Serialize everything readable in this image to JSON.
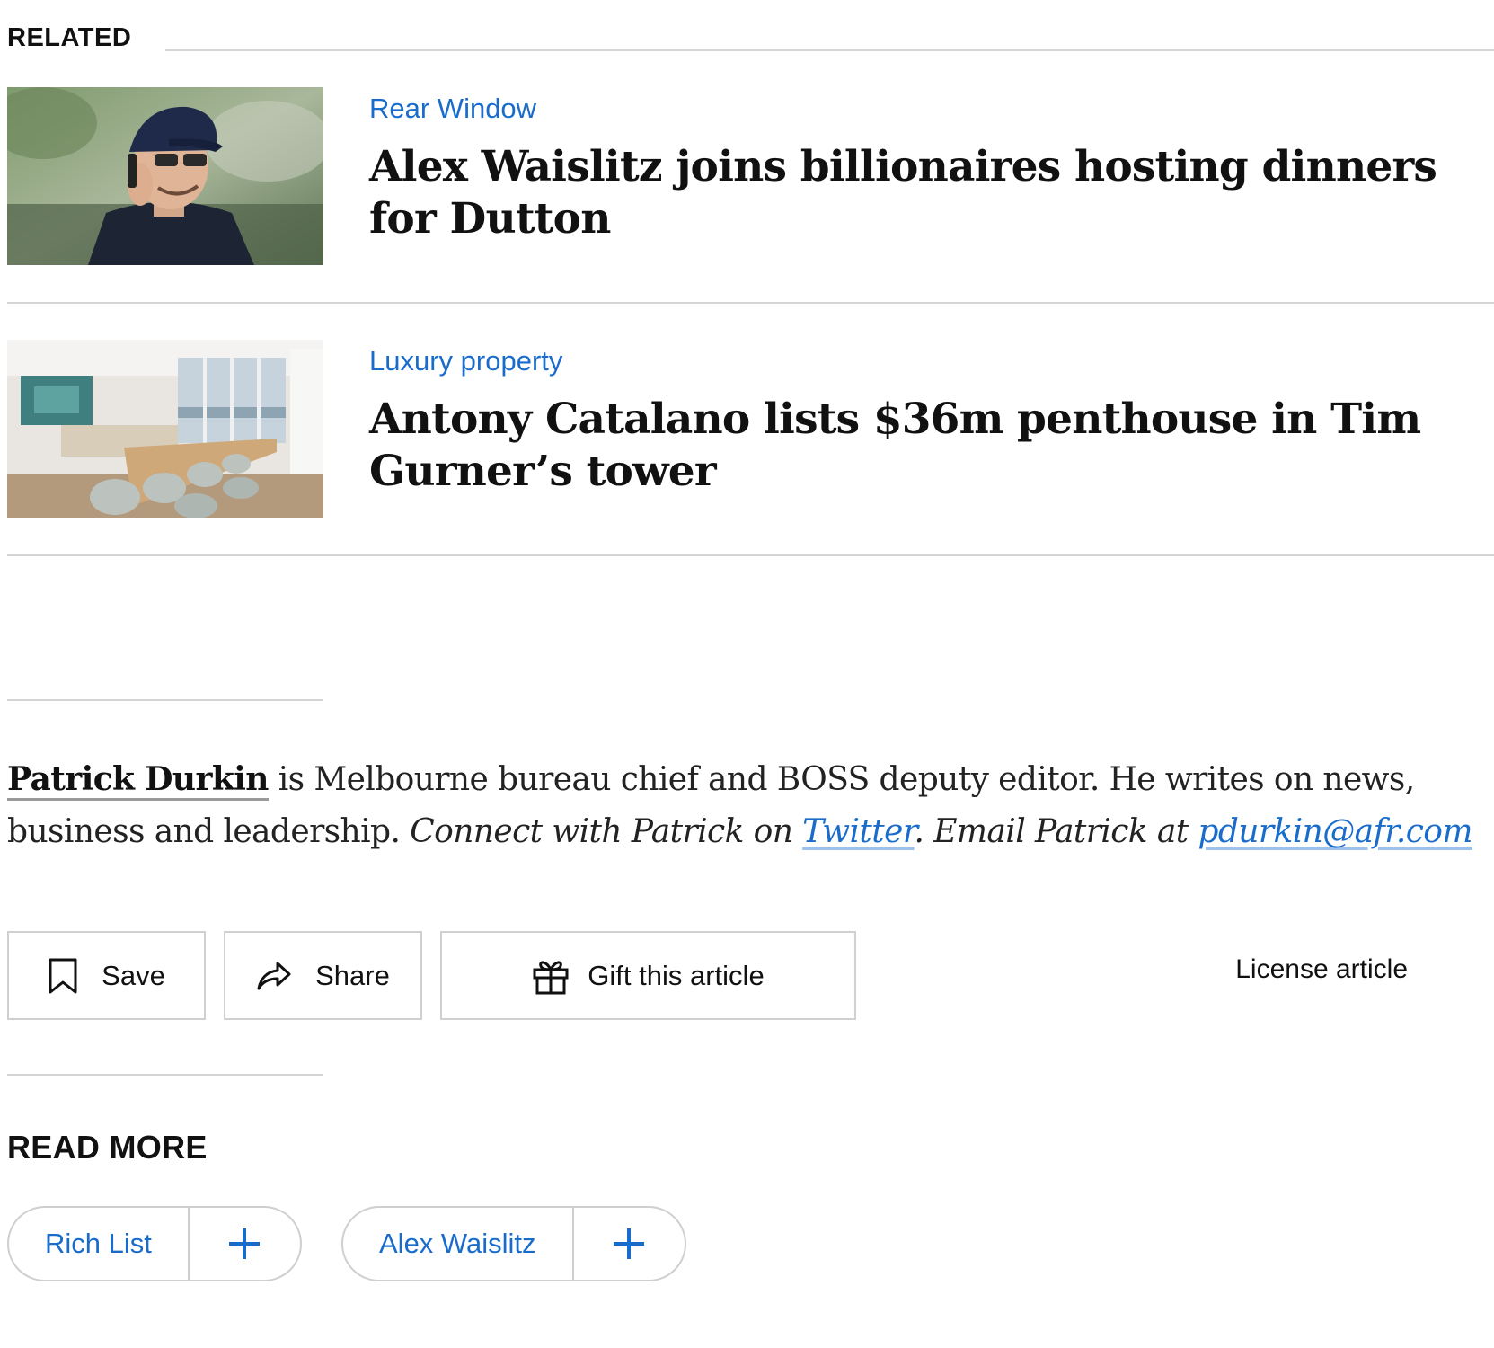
{
  "related": {
    "title": "RELATED",
    "items": [
      {
        "kicker": "Rear Window",
        "headline": "Alex Waislitz joins billionaires hosting dinners for Dutton",
        "image": "photo of man in cap on phone"
      },
      {
        "kicker": "Luxury property",
        "headline": "Antony Catalano lists $36m penthouse in Tim Gurner’s tower",
        "image": "photo of penthouse dining room"
      }
    ]
  },
  "bio": {
    "author": "Patrick Durkin",
    "text": " is Melbourne bureau chief and BOSS deputy editor. He writes on news, business and leadership. ",
    "connect_prefix": "Connect with Patrick on ",
    "twitter_label": "Twitter",
    "email_prefix": ". Email Patrick at ",
    "email": "pdurkin@afr.com"
  },
  "actions": {
    "save_label": "Save",
    "share_label": "Share",
    "gift_label": "Gift this article",
    "license_label": "License article"
  },
  "read_more": {
    "title": "READ MORE",
    "topics": [
      {
        "label": "Rich List"
      },
      {
        "label": "Alex Waislitz"
      }
    ]
  },
  "colors": {
    "accent": "#1a6ccb",
    "rule": "#d4d4d4",
    "text": "#111111"
  }
}
